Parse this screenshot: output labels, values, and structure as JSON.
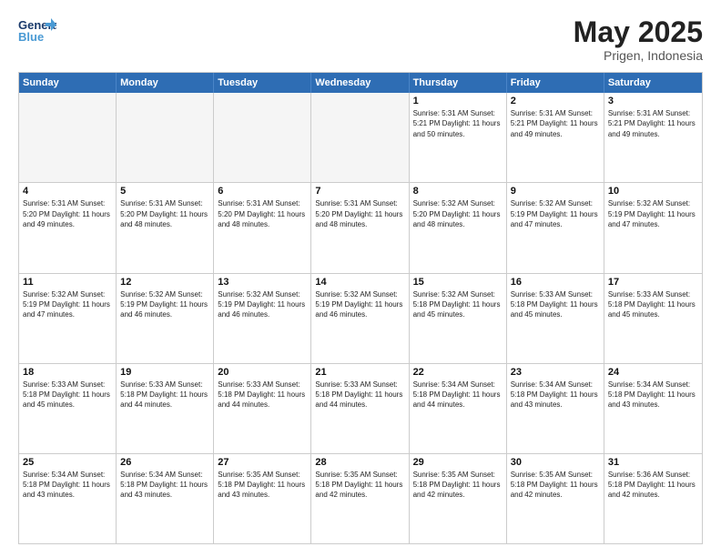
{
  "logo": {
    "line1": "General",
    "line2": "Blue"
  },
  "title": "May 2025",
  "subtitle": "Prigen, Indonesia",
  "header_days": [
    "Sunday",
    "Monday",
    "Tuesday",
    "Wednesday",
    "Thursday",
    "Friday",
    "Saturday"
  ],
  "weeks": [
    [
      {
        "day": "",
        "info": "",
        "empty": true
      },
      {
        "day": "",
        "info": "",
        "empty": true
      },
      {
        "day": "",
        "info": "",
        "empty": true
      },
      {
        "day": "",
        "info": "",
        "empty": true
      },
      {
        "day": "1",
        "info": "Sunrise: 5:31 AM\nSunset: 5:21 PM\nDaylight: 11 hours\nand 50 minutes.",
        "empty": false
      },
      {
        "day": "2",
        "info": "Sunrise: 5:31 AM\nSunset: 5:21 PM\nDaylight: 11 hours\nand 49 minutes.",
        "empty": false
      },
      {
        "day": "3",
        "info": "Sunrise: 5:31 AM\nSunset: 5:21 PM\nDaylight: 11 hours\nand 49 minutes.",
        "empty": false
      }
    ],
    [
      {
        "day": "4",
        "info": "Sunrise: 5:31 AM\nSunset: 5:20 PM\nDaylight: 11 hours\nand 49 minutes.",
        "empty": false
      },
      {
        "day": "5",
        "info": "Sunrise: 5:31 AM\nSunset: 5:20 PM\nDaylight: 11 hours\nand 48 minutes.",
        "empty": false
      },
      {
        "day": "6",
        "info": "Sunrise: 5:31 AM\nSunset: 5:20 PM\nDaylight: 11 hours\nand 48 minutes.",
        "empty": false
      },
      {
        "day": "7",
        "info": "Sunrise: 5:31 AM\nSunset: 5:20 PM\nDaylight: 11 hours\nand 48 minutes.",
        "empty": false
      },
      {
        "day": "8",
        "info": "Sunrise: 5:32 AM\nSunset: 5:20 PM\nDaylight: 11 hours\nand 48 minutes.",
        "empty": false
      },
      {
        "day": "9",
        "info": "Sunrise: 5:32 AM\nSunset: 5:19 PM\nDaylight: 11 hours\nand 47 minutes.",
        "empty": false
      },
      {
        "day": "10",
        "info": "Sunrise: 5:32 AM\nSunset: 5:19 PM\nDaylight: 11 hours\nand 47 minutes.",
        "empty": false
      }
    ],
    [
      {
        "day": "11",
        "info": "Sunrise: 5:32 AM\nSunset: 5:19 PM\nDaylight: 11 hours\nand 47 minutes.",
        "empty": false
      },
      {
        "day": "12",
        "info": "Sunrise: 5:32 AM\nSunset: 5:19 PM\nDaylight: 11 hours\nand 46 minutes.",
        "empty": false
      },
      {
        "day": "13",
        "info": "Sunrise: 5:32 AM\nSunset: 5:19 PM\nDaylight: 11 hours\nand 46 minutes.",
        "empty": false
      },
      {
        "day": "14",
        "info": "Sunrise: 5:32 AM\nSunset: 5:19 PM\nDaylight: 11 hours\nand 46 minutes.",
        "empty": false
      },
      {
        "day": "15",
        "info": "Sunrise: 5:32 AM\nSunset: 5:18 PM\nDaylight: 11 hours\nand 45 minutes.",
        "empty": false
      },
      {
        "day": "16",
        "info": "Sunrise: 5:33 AM\nSunset: 5:18 PM\nDaylight: 11 hours\nand 45 minutes.",
        "empty": false
      },
      {
        "day": "17",
        "info": "Sunrise: 5:33 AM\nSunset: 5:18 PM\nDaylight: 11 hours\nand 45 minutes.",
        "empty": false
      }
    ],
    [
      {
        "day": "18",
        "info": "Sunrise: 5:33 AM\nSunset: 5:18 PM\nDaylight: 11 hours\nand 45 minutes.",
        "empty": false
      },
      {
        "day": "19",
        "info": "Sunrise: 5:33 AM\nSunset: 5:18 PM\nDaylight: 11 hours\nand 44 minutes.",
        "empty": false
      },
      {
        "day": "20",
        "info": "Sunrise: 5:33 AM\nSunset: 5:18 PM\nDaylight: 11 hours\nand 44 minutes.",
        "empty": false
      },
      {
        "day": "21",
        "info": "Sunrise: 5:33 AM\nSunset: 5:18 PM\nDaylight: 11 hours\nand 44 minutes.",
        "empty": false
      },
      {
        "day": "22",
        "info": "Sunrise: 5:34 AM\nSunset: 5:18 PM\nDaylight: 11 hours\nand 44 minutes.",
        "empty": false
      },
      {
        "day": "23",
        "info": "Sunrise: 5:34 AM\nSunset: 5:18 PM\nDaylight: 11 hours\nand 43 minutes.",
        "empty": false
      },
      {
        "day": "24",
        "info": "Sunrise: 5:34 AM\nSunset: 5:18 PM\nDaylight: 11 hours\nand 43 minutes.",
        "empty": false
      }
    ],
    [
      {
        "day": "25",
        "info": "Sunrise: 5:34 AM\nSunset: 5:18 PM\nDaylight: 11 hours\nand 43 minutes.",
        "empty": false
      },
      {
        "day": "26",
        "info": "Sunrise: 5:34 AM\nSunset: 5:18 PM\nDaylight: 11 hours\nand 43 minutes.",
        "empty": false
      },
      {
        "day": "27",
        "info": "Sunrise: 5:35 AM\nSunset: 5:18 PM\nDaylight: 11 hours\nand 43 minutes.",
        "empty": false
      },
      {
        "day": "28",
        "info": "Sunrise: 5:35 AM\nSunset: 5:18 PM\nDaylight: 11 hours\nand 42 minutes.",
        "empty": false
      },
      {
        "day": "29",
        "info": "Sunrise: 5:35 AM\nSunset: 5:18 PM\nDaylight: 11 hours\nand 42 minutes.",
        "empty": false
      },
      {
        "day": "30",
        "info": "Sunrise: 5:35 AM\nSunset: 5:18 PM\nDaylight: 11 hours\nand 42 minutes.",
        "empty": false
      },
      {
        "day": "31",
        "info": "Sunrise: 5:36 AM\nSunset: 5:18 PM\nDaylight: 11 hours\nand 42 minutes.",
        "empty": false
      }
    ]
  ]
}
